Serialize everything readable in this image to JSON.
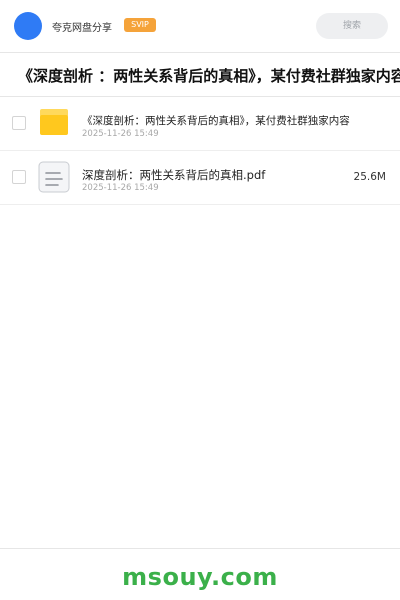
{
  "header": {
    "app_name": "夸克网盘分享",
    "svip_label": "SVIP",
    "search_placeholder": "搜索"
  },
  "folder_title": "《深度剖析 ：两性关系背后的真相》，某付费社群独家内容",
  "files": [
    {
      "icon": "folder-icon",
      "name": "《深度剖析：两性关系背后的真相》，某付费社群独家内容",
      "date": "2025-11-26 15:49",
      "size": ""
    },
    {
      "icon": "document-icon",
      "name": "深度剖析：两性关系背后的真相.pdf",
      "date": "2025-11-26 15:49",
      "size": "25.6M"
    }
  ],
  "footer": {
    "watermark": "msouy.com"
  },
  "colors": {
    "avatar_blue": "#2f7bf5",
    "svip_orange": "#f5a33a",
    "folder_yellow": "#ffc81e",
    "folder_tab": "#ffd95c",
    "watermark_green": "#3bb04a"
  }
}
